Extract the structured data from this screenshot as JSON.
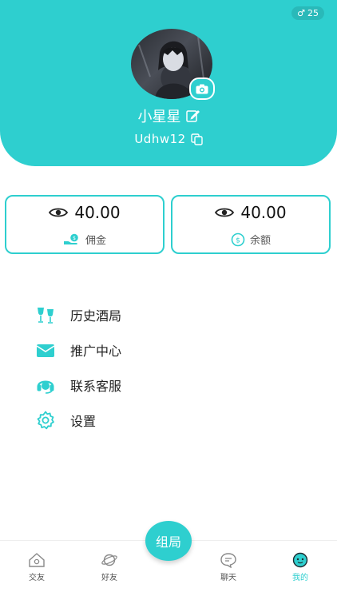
{
  "profile": {
    "gender_age": "25",
    "nickname": "小星星",
    "user_id": "Udhw12"
  },
  "cards": [
    {
      "value": "40.00",
      "label": "佣金"
    },
    {
      "value": "40.00",
      "label": "余额"
    }
  ],
  "menu": [
    {
      "label": "历史酒局",
      "icon": "wine-glasses-icon"
    },
    {
      "label": "推广中心",
      "icon": "envelope-icon"
    },
    {
      "label": "联系客服",
      "icon": "headset-icon"
    },
    {
      "label": "设置",
      "icon": "gear-icon"
    }
  ],
  "fab": {
    "label": "组局"
  },
  "tabs": [
    {
      "label": "交友",
      "icon": "home-icon"
    },
    {
      "label": "好友",
      "icon": "planet-icon"
    },
    {
      "label": "聊天",
      "icon": "chat-bubble-icon"
    },
    {
      "label": "我的",
      "icon": "face-icon"
    }
  ],
  "colors": {
    "accent": "#2ECFCF"
  }
}
